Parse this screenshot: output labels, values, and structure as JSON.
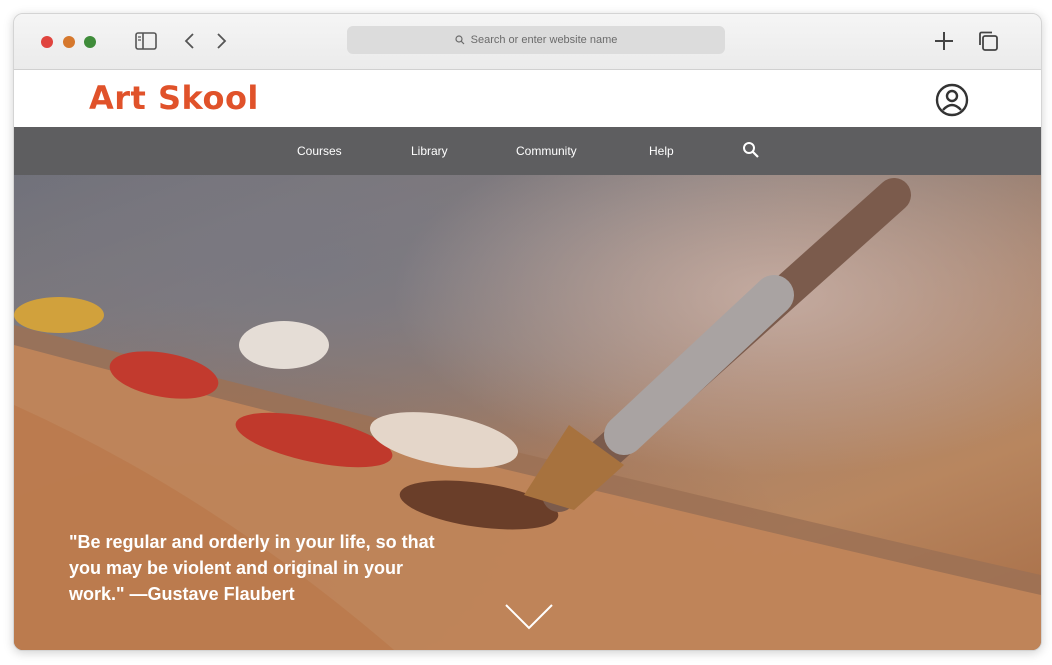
{
  "browser": {
    "address_placeholder": "Search or enter website name",
    "icons": [
      "sidebar-icon",
      "back-icon",
      "forward-icon",
      "search-icon",
      "new-tab-icon",
      "tabs-overview-icon"
    ]
  },
  "site": {
    "logo": "Art Skool",
    "brand_color": "#e0522a",
    "nav_color": "#5e5e60",
    "nav": [
      {
        "label": "Courses"
      },
      {
        "label": "Library"
      },
      {
        "label": "Community"
      },
      {
        "label": "Help"
      }
    ]
  },
  "hero": {
    "quote": "\"Be regular and orderly in your life, so that you may be violent and original in your work.\" —Gustave Flaubert"
  }
}
